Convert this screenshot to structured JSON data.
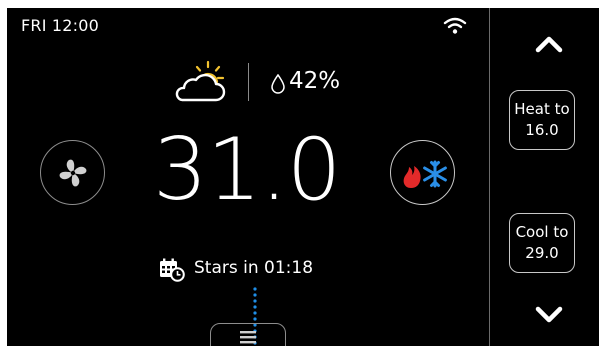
{
  "status": {
    "day_time": "FRI 12:00",
    "wifi_icon": "wifi-icon"
  },
  "weather": {
    "icon": "partly-cloudy-icon",
    "humidity": "42%",
    "humidity_icon": "droplet-icon"
  },
  "controls": {
    "fan_icon": "fan-icon",
    "mode_icon": "heat-cool-mode-icon"
  },
  "temperature": {
    "value": "31.0"
  },
  "schedule": {
    "icon": "calendar-clock-icon",
    "text": "Stars in 01:18"
  },
  "sidebar": {
    "up_icon": "chevron-up-icon",
    "down_icon": "chevron-down-icon",
    "heat": {
      "line1": "Heat to",
      "line2": "16.0"
    },
    "cool": {
      "line1": "Cool to",
      "line2": "29.0"
    }
  },
  "colors": {
    "flame": "#e32a2a",
    "snowflake": "#2a8fe8",
    "dots": "#1f8ee6"
  }
}
